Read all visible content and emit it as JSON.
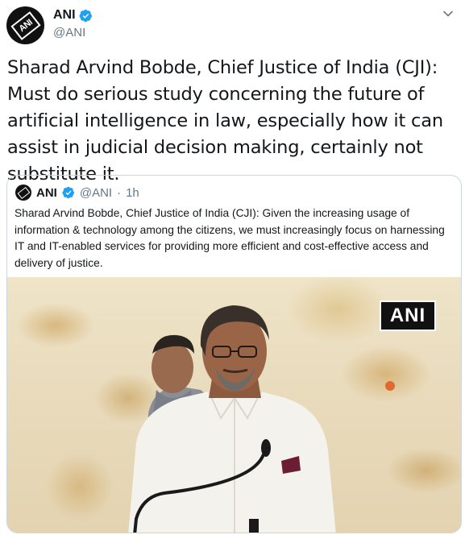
{
  "author": {
    "name": "ANI",
    "handle": "@ANI",
    "avatar_logo": "ANI",
    "verified": true
  },
  "tweet": {
    "text": "Sharad Arvind Bobde, Chief Justice of India (CJI): Must do serious study concerning the future of artificial intelligence in law, especially how it can assist in judicial decision making, certainly not substitute it."
  },
  "quoted": {
    "name": "ANI",
    "handle": "@ANI",
    "separator": "·",
    "time": "1h",
    "text": "Sharad Arvind Bobde, Chief Justice of India (CJI): Given the increasing usage of information & technology among the citizens, we must increasingly focus on harnessing IT and IT-enabled services for providing more efficient and cost-effective access and delivery of justice.",
    "media_watermark": "ANI"
  },
  "icons": {
    "verified": "verified-badge-icon",
    "menu": "chevron-down-icon"
  },
  "colors": {
    "verified_blue": "#1da1f2",
    "secondary_text": "#657786",
    "border": "#ccd6dd"
  }
}
